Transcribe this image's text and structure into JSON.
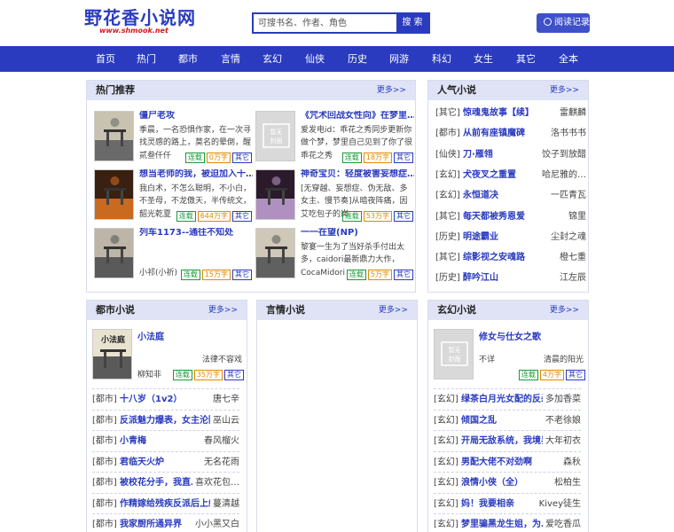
{
  "header": {
    "site_name": "野花香小说网",
    "site_url": "www.shmook.net",
    "search_placeholder": "可搜书名、作者、角色",
    "search_button": "搜 索",
    "history_button": "阅读记录"
  },
  "nav": [
    "首页",
    "热门",
    "都市",
    "言情",
    "玄幻",
    "仙侠",
    "历史",
    "网游",
    "科幻",
    "女生",
    "其它",
    "全本"
  ],
  "hot": {
    "title": "热门推荐",
    "more": "更多>>",
    "books": [
      {
        "cover": "cover-1",
        "name": "僵尸老攻",
        "desc": "季晨，一名恐惧作家，在一次寻找灵感的路上，莫名的晕倒，醒",
        "author": "贰叁仟仟",
        "tags": [
          "连载",
          "0万字",
          "其它"
        ]
      },
      {
        "cover": "placeholder",
        "name": "《咒术回战女性向》在梦里…",
        "desc": "爱发电id：乖花之秀同步更新你做个梦，梦里自己见到了你了很",
        "author": "乖花之秀",
        "tags": [
          "连载",
          "18万字",
          "其它"
        ]
      },
      {
        "cover": "cover-3",
        "name": "想当老师的我，被迫加入十…",
        "desc": "我白术，不怎么聪明，不小白，不圣母，不龙傲天，半传统文，比较慢",
        "author": "韶光乾夏",
        "tags": [
          "连载",
          "644万字",
          "其它"
        ]
      },
      {
        "cover": "cover-4",
        "name": "神奇宝贝：轻度被害妄想症…",
        "desc": "[无穿越、妄想症、伪无敌、多女主、慢节奏]从暗夜阵痛，因为",
        "author": "艾吃包子的岚",
        "tags": [
          "连载",
          "53万字",
          "其它"
        ]
      },
      {
        "cover": "cover-5",
        "name": "列车1173--通往不知处",
        "desc": "",
        "author": "小祁(小祈)",
        "tags": [
          "连载",
          "15万字",
          "其它"
        ]
      },
      {
        "cover": "cover-6",
        "name": "一一在望(NP)",
        "desc": "黎宴一生为了当好杀手付出太多，caidori最新鼎力大作，2019",
        "author": "CocaMidori",
        "tags": [
          "连载",
          "5万字",
          "其它"
        ]
      }
    ]
  },
  "popular": {
    "title": "人气小说",
    "more": "更多>>",
    "items": [
      {
        "cat": "[其它]",
        "name": "惊魂鬼故事【续】",
        "author": "雷麒麟"
      },
      {
        "cat": "[都市]",
        "name": "从前有座镇魔碑",
        "author": "洛书书书"
      },
      {
        "cat": "[仙侠]",
        "name": "刀·雁翎",
        "author": "饺子到放醋"
      },
      {
        "cat": "[玄幻]",
        "name": "犬夜叉之重置",
        "author": "哈尼雅的…"
      },
      {
        "cat": "[玄幻]",
        "name": "永恒道决",
        "author": "一匹青瓦"
      },
      {
        "cat": "[其它]",
        "name": "每天都被秀恩爱",
        "author": "锦里"
      },
      {
        "cat": "[历史]",
        "name": "明途霸业",
        "author": "尘封之魂"
      },
      {
        "cat": "[其它]",
        "name": "综影视之安魂路",
        "author": "橙七重"
      },
      {
        "cat": "[历史]",
        "name": "醉吟江山",
        "author": "江左辰"
      }
    ]
  },
  "urban": {
    "title": "都市小说",
    "more": "更多>>",
    "featured": {
      "name": "小法庭",
      "desc": "法律不容戏",
      "author": "柳知非",
      "tags": [
        "连载",
        "35万字",
        "其它"
      ]
    },
    "items": [
      {
        "cat": "[都市]",
        "name": "十八岁（1v2）",
        "author": "唐七辛"
      },
      {
        "cat": "[都市]",
        "name": "反派魅力爆表，女主沦陷…",
        "author": "巫山云"
      },
      {
        "cat": "[都市]",
        "name": "小青梅",
        "author": "春风榴火"
      },
      {
        "cat": "[都市]",
        "name": "君临天火炉",
        "author": "无名花雨"
      },
      {
        "cat": "[都市]",
        "name": "被校花分手，我直…",
        "author": "喜欢花包…"
      },
      {
        "cat": "[都市]",
        "name": "作精嫁给残疾反派后上综…",
        "author": "蔓清越"
      },
      {
        "cat": "[都市]",
        "name": "我家厨所通异界",
        "author": "小小黑又白"
      }
    ]
  },
  "romance": {
    "title": "言情小说",
    "more": "更多>>"
  },
  "fantasy": {
    "title": "玄幻小说",
    "more": "更多>>",
    "featured": {
      "name": "修女与仕女之歌",
      "desc": "不详",
      "author": "清晨的阳光",
      "tags": [
        "连载",
        "4万字",
        "其它"
      ]
    },
    "items": [
      {
        "cat": "[玄幻]",
        "name": "绿茶白月光女配的反杀…",
        "author": "多加香菜"
      },
      {
        "cat": "[玄幻]",
        "name": "倾国之乱",
        "author": "不老徐娘"
      },
      {
        "cat": "[玄幻]",
        "name": "开局无敌系统，我境界…",
        "author": "大年初衣"
      },
      {
        "cat": "[玄幻]",
        "name": "男配大佬不对劲啊",
        "author": "森秋"
      },
      {
        "cat": "[玄幻]",
        "name": "浪情小侠（全）",
        "author": "松柏生"
      },
      {
        "cat": "[玄幻]",
        "name": "妈！我要相亲",
        "author": "Kivey徒生"
      },
      {
        "cat": "[玄幻]",
        "name": "梦里骗黑龙生姐，为…",
        "author": "爱吃香瓜"
      }
    ]
  },
  "placeholder_cover_text": "暂无封面",
  "colors": {
    "brand": "#2a3bbf",
    "panel_header": "#dfe3f5"
  }
}
